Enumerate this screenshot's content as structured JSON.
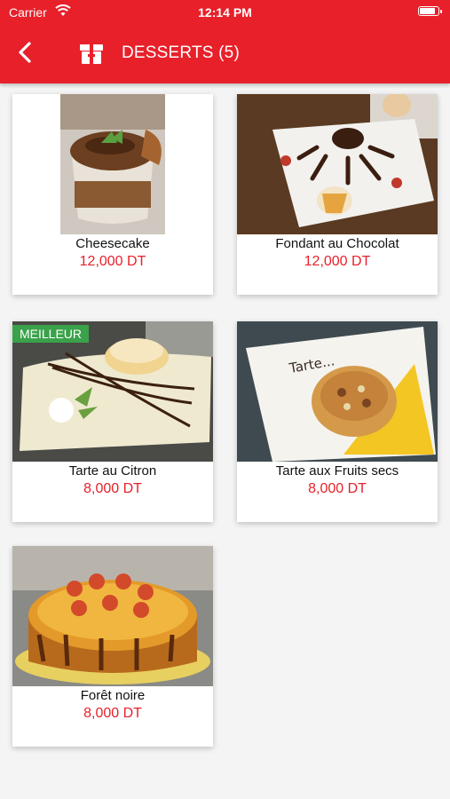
{
  "status_bar": {
    "carrier": "Carrier",
    "time": "12:14 PM",
    "battery_level": 0.9
  },
  "header": {
    "title": "DESSERTS (5)",
    "back_icon": "chevron-left-icon",
    "category_icon": "gift-box-icon"
  },
  "colors": {
    "brand": "#e8202a",
    "badge": "#3aa24a",
    "background": "#f4f4f4"
  },
  "products": [
    {
      "name": "Cheesecake",
      "price": "12,000 DT"
    },
    {
      "name": "Fondant au Chocolat",
      "price": "12,000 DT"
    },
    {
      "name": "Tarte au Citron",
      "price": "8,000 DT",
      "badge": "MEILLEUR"
    },
    {
      "name": "Tarte aux Fruits secs",
      "price": "8,000 DT"
    },
    {
      "name": "Forêt noire",
      "price": "8,000 DT"
    }
  ]
}
